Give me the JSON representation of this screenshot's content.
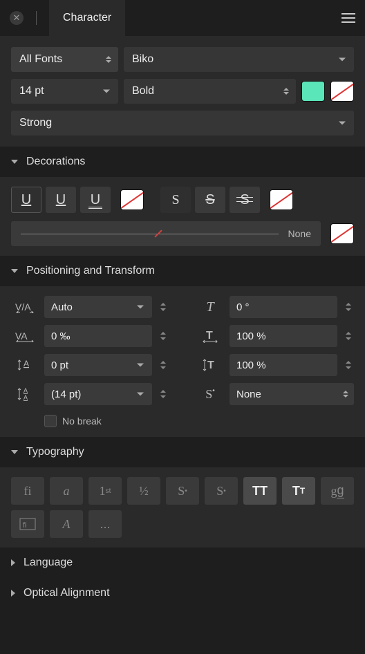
{
  "panel_title": "Character",
  "collection": "All Fonts",
  "font_family": "Biko",
  "font_size": "14 pt",
  "font_style": "Bold",
  "char_style": "Strong",
  "fill_color": "#5AE6B8",
  "sections": {
    "decorations": "Decorations",
    "positioning": "Positioning and Transform",
    "typography": "Typography",
    "language": "Language",
    "optical": "Optical Alignment"
  },
  "stroke_label": "None",
  "positioning": {
    "kerning": "Auto",
    "tracking": "0 ‰",
    "baseline": "0 pt",
    "leading": "(14 pt)",
    "shear": "0 °",
    "scale_x": "100 %",
    "scale_y": "100 %",
    "caps": "None",
    "no_break": "No break"
  },
  "typo_more": "..."
}
